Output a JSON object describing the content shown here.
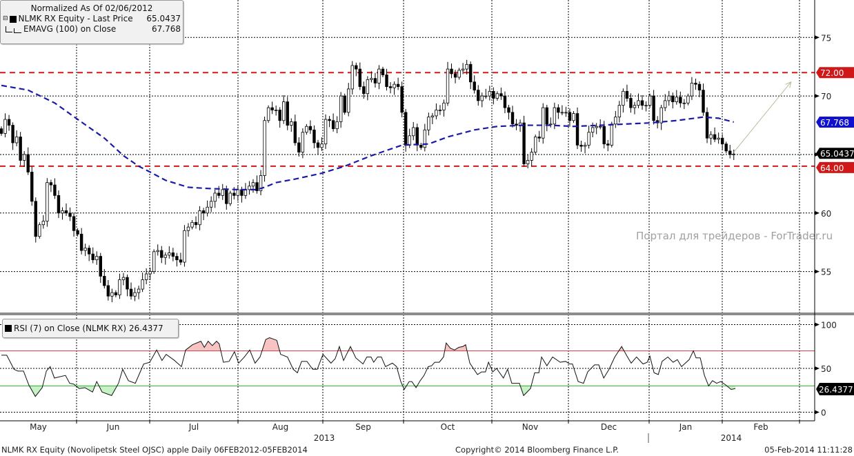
{
  "legend": {
    "title": "Normalized As Of 02/06/2012",
    "series": [
      {
        "label": "NLMK RX Equity - Last Price",
        "value": "65.0437",
        "icon": "filled-square-icon"
      },
      {
        "label": "EMAVG (100) on Close",
        "value": "67.768",
        "icon": "dashed-line-icon"
      }
    ]
  },
  "rsi_legend": {
    "label": "RSI (7) on Close (NLMK RX)",
    "value": "26.4377"
  },
  "watermark": "Портал для трейдеров - ForTrader.ru",
  "footer": {
    "left": "NLMK RX Equity (Novolipetsk Steel OJSC) apple  Daily 06FEB2012-05FEB2014",
    "center": "Copyright© 2014 Bloomberg Finance L.P.",
    "right": "05-Feb-2014 11:11:28"
  },
  "colors": {
    "resistance": "#d01818",
    "ema": "#1a1aa8",
    "rsi_upper": "#c04040",
    "rsi_lower": "#2aa82a",
    "arrow": "#b9bc9c"
  },
  "chart_data": {
    "type": "candlestick",
    "x_months": [
      "May",
      "Jun",
      "Jul",
      "Aug",
      "Sep",
      "Oct",
      "Nov",
      "Dec",
      "Jan",
      "Feb"
    ],
    "x_years": [
      "2013",
      "2014"
    ],
    "price_panel": {
      "ylim": [
        51.5,
        78.2
      ],
      "y_ticks": [
        "75",
        "70",
        "65",
        "60",
        "55"
      ],
      "y_tick_values": [
        75,
        70,
        65,
        60,
        55
      ],
      "first_open": 67.2,
      "closes": [
        66.8,
        68,
        67.5,
        66,
        66.5,
        64.5,
        65,
        63.5,
        61,
        58,
        59,
        59.3,
        62.6,
        62.4,
        61.5,
        60,
        60.2,
        60,
        59.7,
        58.5,
        58.2,
        56.8,
        57,
        56.5,
        56,
        56.3,
        54.6,
        53.8,
        52.9,
        53.2,
        53,
        54.3,
        54.5,
        53.5,
        52.9,
        53.2,
        53.5,
        54.3,
        54.8,
        55,
        56.7,
        56.8,
        56.2,
        56.4,
        56.6,
        56.3,
        56,
        55.8,
        58.5,
        58.8,
        59.2,
        59,
        60.2,
        60,
        60.5,
        61,
        61.7,
        61.5,
        62,
        60.8,
        61.7,
        61.5,
        62,
        61.5,
        62,
        62.3,
        62.6,
        61.9,
        63.2,
        67.9,
        69,
        68.8,
        68.8,
        67.9,
        69.5,
        67.5,
        67.8,
        66,
        65.2,
        66.9,
        67.4,
        67.1,
        66,
        65.6,
        65.9,
        68,
        67.9,
        67.2,
        67.8,
        70,
        68.6,
        70.6,
        72.6,
        72.3,
        70.8,
        70.2,
        71.4,
        71.5,
        71.1,
        72.3,
        71.8,
        70.8,
        70.7,
        71,
        70.8,
        68.6,
        65.8,
        66.6,
        67.3,
        65.8,
        65.6,
        67.1,
        68.2,
        68.3,
        68.8,
        68.8,
        69.4,
        72.3,
        71.9,
        71.6,
        72.2,
        72.3,
        72.7,
        71.2,
        70.5,
        69.6,
        70,
        70,
        70.4,
        69.8,
        70.2,
        70,
        69,
        68.6,
        67.6,
        67.5,
        67.7,
        64.2,
        64.5,
        65.2,
        66.5,
        66.4,
        69,
        67.6,
        67.6,
        69,
        68.6,
        68.6,
        68.6,
        67.9,
        68.5,
        65.8,
        65.7,
        65.8,
        66.9,
        67.3,
        67.4,
        67.4,
        65.9,
        65.8,
        67.6,
        68.2,
        69.2,
        70.4,
        69.8,
        69,
        69.2,
        69.6,
        69.2,
        69.2,
        70,
        67.9,
        67.7,
        69,
        69.6,
        70,
        69.5,
        69.9,
        69.4,
        69.4,
        70,
        71.1,
        71,
        70.5,
        68.6,
        66.4,
        66.7,
        66.3,
        66.4,
        65.9,
        65.3,
        65.0,
        65.04
      ],
      "ema100": [
        [
          0,
          70.9
        ],
        [
          7,
          70.5
        ],
        [
          14,
          69.4
        ],
        [
          20,
          68.0
        ],
        [
          27,
          66.4
        ],
        [
          32,
          64.9
        ],
        [
          36,
          64.0
        ],
        [
          39,
          63.5
        ],
        [
          43,
          62.8
        ],
        [
          49,
          62.2
        ],
        [
          54,
          62.1
        ],
        [
          62,
          62.0
        ],
        [
          67,
          62.0
        ],
        [
          69,
          62.2
        ],
        [
          72,
          62.6
        ],
        [
          77,
          62.9
        ],
        [
          84,
          63.4
        ],
        [
          90,
          64.0
        ],
        [
          97,
          64.9
        ],
        [
          105,
          65.8
        ],
        [
          112,
          65.9
        ],
        [
          117,
          66.5
        ],
        [
          124,
          67.1
        ],
        [
          130,
          67.4
        ],
        [
          137,
          67.5
        ],
        [
          144,
          67.5
        ],
        [
          150,
          67.4
        ],
        [
          157,
          67.5
        ],
        [
          170,
          67.7
        ],
        [
          177,
          67.9
        ],
        [
          184,
          68.2
        ],
        [
          188,
          68.1
        ],
        [
          192,
          67.77
        ]
      ],
      "horizontal_lines": [
        {
          "value": 72.0,
          "label": "72.00"
        },
        {
          "value": 64.0,
          "label": "64.00"
        }
      ],
      "price_tags": [
        {
          "value": 67.768,
          "label": "67.768",
          "kind": "ema"
        },
        {
          "value": 65.0437,
          "label": "65.0437",
          "kind": "last"
        }
      ],
      "arrow": {
        "from": [
          192,
          65.2
        ],
        "to": [
          207,
          71.2
        ]
      }
    },
    "rsi_panel": {
      "ylim": [
        -9.8,
        109.8
      ],
      "y_ticks": [
        "100",
        "50",
        "0"
      ],
      "y_tick_values": [
        100,
        50,
        0
      ],
      "upper": 70,
      "lower": 30,
      "last": {
        "value": 26.4377,
        "label": "26.4377"
      },
      "points": [
        [
          0,
          65
        ],
        [
          1.4,
          65
        ],
        [
          3.3,
          49
        ],
        [
          4.3,
          47
        ],
        [
          5.8,
          47
        ],
        [
          7.2,
          31
        ],
        [
          8.9,
          18
        ],
        [
          10.7,
          28
        ],
        [
          11.8,
          47
        ],
        [
          12.8,
          52
        ],
        [
          13.9,
          39
        ],
        [
          16.8,
          42
        ],
        [
          17.9,
          33
        ],
        [
          19,
          32
        ],
        [
          20.4,
          27
        ],
        [
          21.9,
          28
        ],
        [
          23.9,
          23
        ],
        [
          25,
          35
        ],
        [
          26.4,
          23
        ],
        [
          28.9,
          19
        ],
        [
          30.7,
          33
        ],
        [
          31.8,
          49
        ],
        [
          33.3,
          36
        ],
        [
          35.1,
          33
        ],
        [
          37.3,
          55
        ],
        [
          38.9,
          57
        ],
        [
          40.7,
          71
        ],
        [
          42.1,
          59
        ],
        [
          43.2,
          66
        ],
        [
          45.4,
          59
        ],
        [
          47.2,
          52
        ],
        [
          48.3,
          71
        ],
        [
          50.1,
          77
        ],
        [
          52.3,
          81
        ],
        [
          53.2,
          74
        ],
        [
          54.2,
          81
        ],
        [
          55.3,
          76
        ],
        [
          56.4,
          81
        ],
        [
          57.1,
          78
        ],
        [
          58.2,
          57
        ],
        [
          59.7,
          58
        ],
        [
          61.1,
          69
        ],
        [
          62.2,
          56
        ],
        [
          63.7,
          63
        ],
        [
          65.1,
          71
        ],
        [
          66.5,
          56
        ],
        [
          67.8,
          63
        ],
        [
          69.3,
          83
        ],
        [
          70.3,
          85
        ],
        [
          72.2,
          82
        ],
        [
          73.2,
          66
        ],
        [
          75,
          63
        ],
        [
          76.5,
          49
        ],
        [
          77.6,
          45
        ],
        [
          78.7,
          58
        ],
        [
          80.1,
          58
        ],
        [
          81.6,
          49
        ],
        [
          82.8,
          49
        ],
        [
          84.3,
          66
        ],
        [
          86.4,
          56
        ],
        [
          87.5,
          61
        ],
        [
          88.6,
          75
        ],
        [
          89.7,
          59
        ],
        [
          91.5,
          75
        ],
        [
          92.9,
          62
        ],
        [
          94.8,
          55
        ],
        [
          95.8,
          63
        ],
        [
          96.9,
          63
        ],
        [
          97.6,
          57
        ],
        [
          98.6,
          63
        ],
        [
          99.6,
          63
        ],
        [
          100.7,
          52
        ],
        [
          102.5,
          56
        ],
        [
          103.6,
          52
        ],
        [
          104.7,
          35
        ],
        [
          105.6,
          26
        ],
        [
          106.9,
          35
        ],
        [
          107.6,
          35
        ],
        [
          108.7,
          28
        ],
        [
          109.8,
          36
        ],
        [
          110.8,
          42
        ],
        [
          111.9,
          52
        ],
        [
          112.8,
          53
        ],
        [
          113.6,
          57
        ],
        [
          114.8,
          57
        ],
        [
          115.9,
          63
        ],
        [
          116.6,
          79
        ],
        [
          117.7,
          73
        ],
        [
          118.8,
          71
        ],
        [
          119.9,
          74
        ],
        [
          121,
          75
        ],
        [
          121.7,
          77
        ],
        [
          122.8,
          56
        ],
        [
          124.8,
          43
        ],
        [
          125.9,
          46
        ],
        [
          126.9,
          46
        ],
        [
          127.7,
          57
        ],
        [
          128.8,
          46
        ],
        [
          129.8,
          50
        ],
        [
          131.6,
          39
        ],
        [
          132.7,
          49
        ],
        [
          133.8,
          33
        ],
        [
          135.8,
          33
        ],
        [
          136.9,
          19
        ],
        [
          138.7,
          27
        ],
        [
          139.8,
          45
        ],
        [
          140.9,
          45
        ],
        [
          141.6,
          63
        ],
        [
          143,
          53
        ],
        [
          144.5,
          63
        ],
        [
          146.5,
          57
        ],
        [
          147.9,
          58
        ],
        [
          149,
          55
        ],
        [
          149.7,
          55
        ],
        [
          151.2,
          35
        ],
        [
          152.6,
          33
        ],
        [
          153.7,
          46
        ],
        [
          155.5,
          54
        ],
        [
          156.6,
          54
        ],
        [
          157.9,
          39
        ],
        [
          159.3,
          49
        ],
        [
          160.8,
          63
        ],
        [
          162.6,
          75
        ],
        [
          164,
          64
        ],
        [
          165.1,
          56
        ],
        [
          166.5,
          63
        ],
        [
          168.2,
          55
        ],
        [
          169.3,
          57
        ],
        [
          170,
          64
        ],
        [
          171.1,
          45
        ],
        [
          172.2,
          43
        ],
        [
          173.2,
          58
        ],
        [
          174.7,
          63
        ],
        [
          176.1,
          57
        ],
        [
          177.2,
          60
        ],
        [
          178.3,
          52
        ],
        [
          180.3,
          60
        ],
        [
          181.4,
          70
        ],
        [
          182.1,
          62
        ],
        [
          183.2,
          62
        ],
        [
          184.3,
          42
        ],
        [
          185.4,
          30
        ],
        [
          186.4,
          36
        ],
        [
          187.5,
          33
        ],
        [
          188.6,
          35
        ],
        [
          189.9,
          31
        ],
        [
          191.3,
          26
        ],
        [
          192.4,
          27
        ]
      ]
    }
  }
}
